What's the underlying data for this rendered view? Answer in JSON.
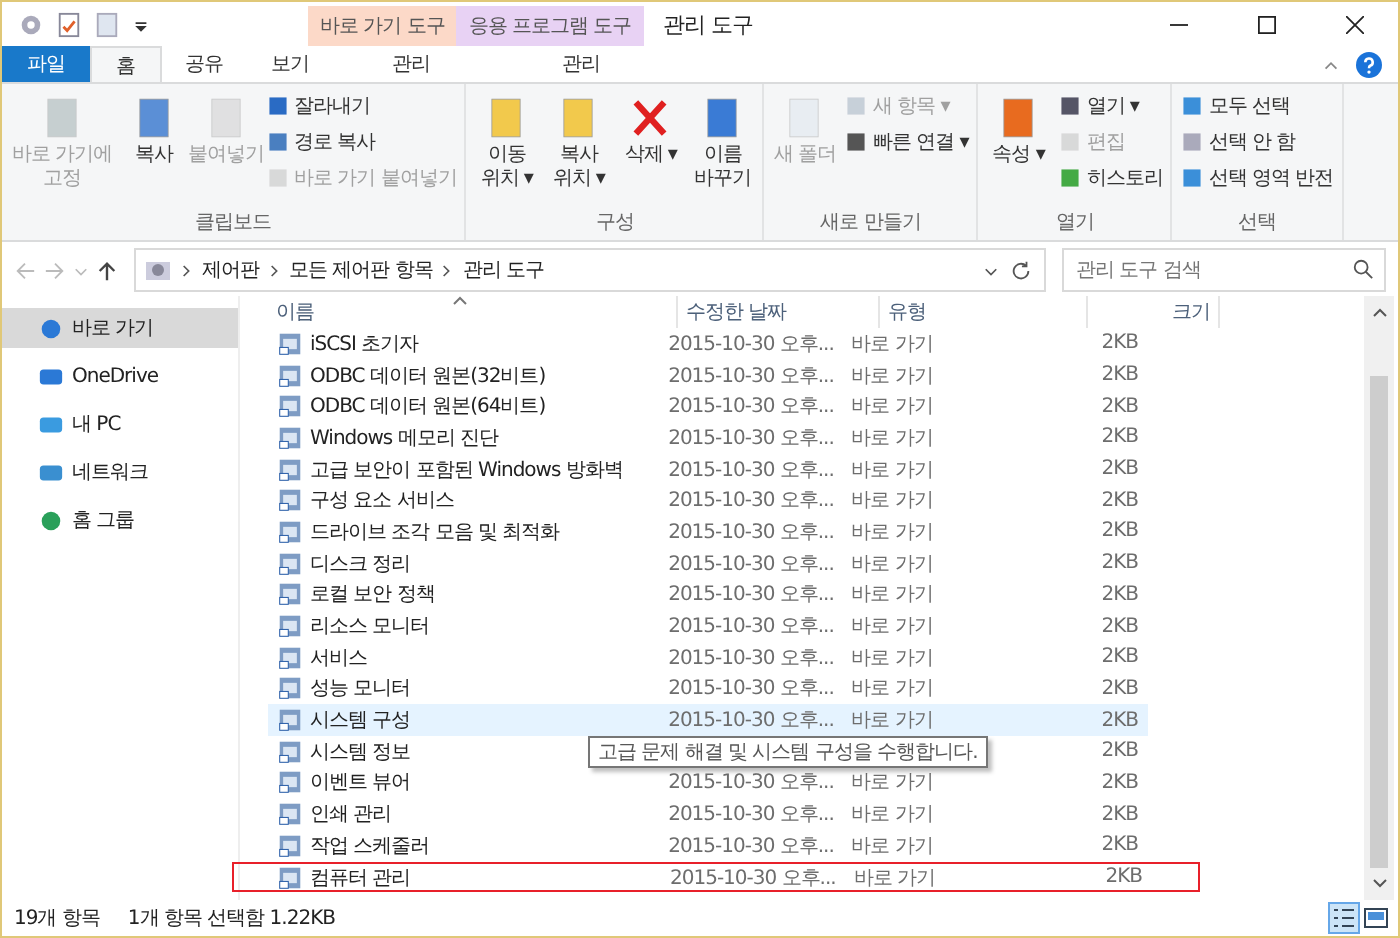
{
  "window": {
    "title": "관리 도구",
    "context_tabs": [
      {
        "label": "바로 가기 도구",
        "color": "#fcd9c8"
      },
      {
        "label": "응용 프로그램 도구",
        "color": "#e8d2f4"
      }
    ]
  },
  "ribbon_tabs": [
    {
      "label": "파일",
      "kind": "file",
      "selected": false
    },
    {
      "label": "홈",
      "kind": "tab",
      "selected": true
    },
    {
      "label": "공유",
      "kind": "tab",
      "selected": false
    },
    {
      "label": "보기",
      "kind": "tab",
      "selected": false
    },
    {
      "label": "관리",
      "kind": "context",
      "selected": false
    },
    {
      "label": "관리",
      "kind": "context",
      "selected": false
    }
  ],
  "ribbon_groups": [
    {
      "label": "클립보드",
      "large": [
        {
          "label": "바로 가기에 고정",
          "disabled": true
        },
        {
          "label": "복사",
          "disabled": false
        },
        {
          "label": "붙여넣기",
          "disabled": true
        }
      ],
      "small": [
        {
          "label": "잘라내기",
          "disabled": false
        },
        {
          "label": "경로 복사",
          "disabled": false
        },
        {
          "label": "바로 가기 붙여넣기",
          "disabled": true
        }
      ]
    },
    {
      "label": "구성",
      "large": [
        {
          "label": "이동 위치 ▾",
          "disabled": false
        },
        {
          "label": "복사 위치 ▾",
          "disabled": false
        },
        {
          "label": "삭제 ▾",
          "disabled": false
        },
        {
          "label": "이름 바꾸기",
          "disabled": false
        }
      ]
    },
    {
      "label": "새로 만들기",
      "large": [
        {
          "label": "새 폴더",
          "disabled": true
        }
      ],
      "small": [
        {
          "label": "새 항목 ▾",
          "disabled": true
        },
        {
          "label": "빠른 연결 ▾",
          "disabled": false
        }
      ]
    },
    {
      "label": "열기",
      "large": [
        {
          "label": "속성 ▾",
          "disabled": false
        }
      ],
      "small": [
        {
          "label": "열기 ▾",
          "disabled": false
        },
        {
          "label": "편집",
          "disabled": true
        },
        {
          "label": "히스토리",
          "disabled": false
        }
      ]
    },
    {
      "label": "선택",
      "small": [
        {
          "label": "모두 선택",
          "disabled": false
        },
        {
          "label": "선택 안 함",
          "disabled": false
        },
        {
          "label": "선택 영역 반전",
          "disabled": false
        }
      ]
    }
  ],
  "address": {
    "crumbs": [
      "제어판",
      "모든 제어판 항목",
      "관리 도구"
    ]
  },
  "search": {
    "placeholder": "관리 도구 검색"
  },
  "sidebar": {
    "items": [
      {
        "label": "바로 가기",
        "selected": true
      },
      {
        "label": "OneDrive",
        "selected": false
      },
      {
        "label": "내 PC",
        "selected": false
      },
      {
        "label": "네트워크",
        "selected": false
      },
      {
        "label": "홈 그룹",
        "selected": false
      }
    ]
  },
  "table": {
    "columns": [
      "이름",
      "수정한 날짜",
      "유형",
      "크기"
    ],
    "rows": [
      {
        "name": "iSCSI 초기자",
        "date": "2015-10-30 오후...",
        "type": "바로 가기",
        "size": "2KB",
        "hovered": false,
        "selected": false
      },
      {
        "name": "ODBC 데이터 원본(32비트)",
        "date": "2015-10-30 오후...",
        "type": "바로 가기",
        "size": "2KB",
        "hovered": false,
        "selected": false
      },
      {
        "name": "ODBC 데이터 원본(64비트)",
        "date": "2015-10-30 오후...",
        "type": "바로 가기",
        "size": "2KB",
        "hovered": false,
        "selected": false
      },
      {
        "name": "Windows 메모리 진단",
        "date": "2015-10-30 오후...",
        "type": "바로 가기",
        "size": "2KB",
        "hovered": false,
        "selected": false
      },
      {
        "name": "고급 보안이 포함된 Windows 방화벽",
        "date": "2015-10-30 오후...",
        "type": "바로 가기",
        "size": "2KB",
        "hovered": false,
        "selected": false
      },
      {
        "name": "구성 요소 서비스",
        "date": "2015-10-30 오후...",
        "type": "바로 가기",
        "size": "2KB",
        "hovered": false,
        "selected": false
      },
      {
        "name": "드라이브 조각 모음 및 최적화",
        "date": "2015-10-30 오후...",
        "type": "바로 가기",
        "size": "2KB",
        "hovered": false,
        "selected": false
      },
      {
        "name": "디스크 정리",
        "date": "2015-10-30 오후...",
        "type": "바로 가기",
        "size": "2KB",
        "hovered": false,
        "selected": false
      },
      {
        "name": "로컬 보안 정책",
        "date": "2015-10-30 오후...",
        "type": "바로 가기",
        "size": "2KB",
        "hovered": false,
        "selected": false
      },
      {
        "name": "리소스 모니터",
        "date": "2015-10-30 오후...",
        "type": "바로 가기",
        "size": "2KB",
        "hovered": false,
        "selected": false
      },
      {
        "name": "서비스",
        "date": "2015-10-30 오후...",
        "type": "바로 가기",
        "size": "2KB",
        "hovered": false,
        "selected": false
      },
      {
        "name": "성능 모니터",
        "date": "2015-10-30 오후...",
        "type": "바로 가기",
        "size": "2KB",
        "hovered": false,
        "selected": false
      },
      {
        "name": "시스템 구성",
        "date": "2015-10-30 오후...",
        "type": "바로 가기",
        "size": "2KB",
        "hovered": true,
        "selected": false
      },
      {
        "name": "시스템 정보",
        "size": "2KB",
        "hovered": false,
        "selected": false
      },
      {
        "name": "이벤트 뷰어",
        "date": "2015-10-30 오후...",
        "type": "바로 가기",
        "size": "2KB",
        "hovered": false,
        "selected": false
      },
      {
        "name": "인쇄 관리",
        "date": "2015-10-30 오후...",
        "type": "바로 가기",
        "size": "2KB",
        "hovered": false,
        "selected": false
      },
      {
        "name": "작업 스케줄러",
        "date": "2015-10-30 오후...",
        "type": "바로 가기",
        "size": "2KB",
        "hovered": false,
        "selected": false
      },
      {
        "name": "컴퓨터 관리",
        "date": "2015-10-30 오후...",
        "type": "바로 가기",
        "size": "2KB",
        "hovered": false,
        "selected": true
      }
    ]
  },
  "tooltip": "고급 문제 해결 및 시스템 구성을 수행합니다.",
  "status_bar": {
    "count": "19개 항목",
    "selection": "1개 항목 선택함 1.22KB"
  }
}
